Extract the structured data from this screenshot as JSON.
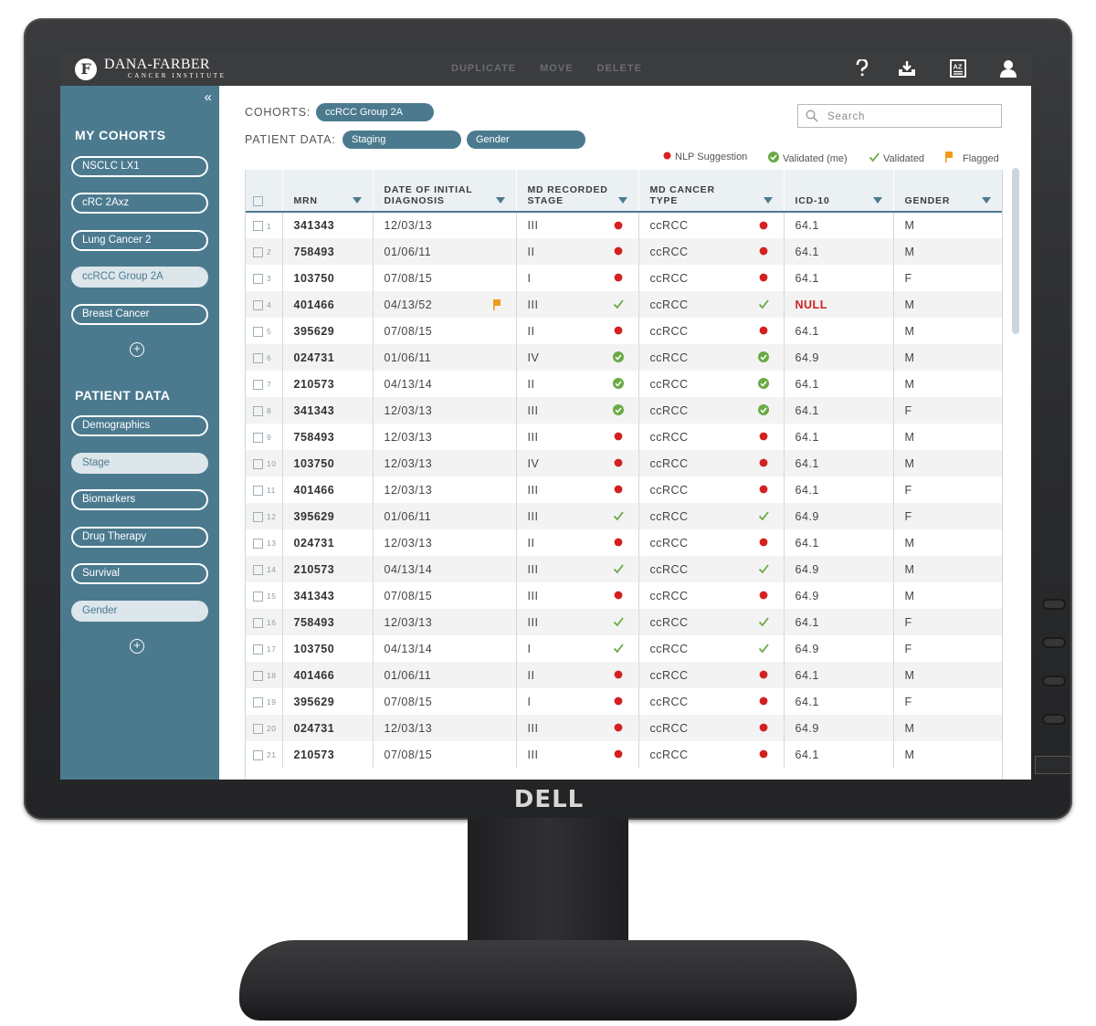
{
  "monitor": {
    "brand": "DELL"
  },
  "app": {
    "org_name": "DANA-FARBER",
    "org_sub": "CANCER INSTITUTE",
    "org_mark": "F",
    "actions": [
      "DUPLICATE",
      "MOVE",
      "DELETE"
    ],
    "icons": [
      "help-icon",
      "export-icon",
      "sort-az-icon",
      "user-icon"
    ]
  },
  "sidebar": {
    "cohorts_heading": "MY COHORTS",
    "cohorts": [
      {
        "label": "NSCLC LX1",
        "active": false
      },
      {
        "label": "cRC 2Axz",
        "active": false
      },
      {
        "label": "Lung Cancer 2",
        "active": false
      },
      {
        "label": "ccRCC Group 2A",
        "active": true
      },
      {
        "label": "Breast Cancer",
        "active": false
      }
    ],
    "patient_heading": "PATIENT DATA",
    "patient_data": [
      {
        "label": "Demographics",
        "active": false
      },
      {
        "label": "Stage",
        "active": true
      },
      {
        "label": "Biomarkers",
        "active": false
      },
      {
        "label": "Drug Therapy",
        "active": false
      },
      {
        "label": "Survival",
        "active": false
      },
      {
        "label": "Gender",
        "active": true
      }
    ]
  },
  "filters": {
    "cohorts_label": "COHORTS:",
    "cohort_chip": "ccRCC Group 2A",
    "patient_label": "PATIENT DATA:",
    "patient_chips": [
      "Staging",
      "Gender"
    ]
  },
  "search": {
    "placeholder": "Search"
  },
  "legend": {
    "nlp": "NLP Suggestion",
    "validated_me": "Validated (me)",
    "validated": "Validated",
    "flagged": "Flagged",
    "colors": {
      "nlp": "#d42020",
      "validated": "#6aaa45",
      "flagged": "#f29a1a"
    }
  },
  "table": {
    "columns": [
      "MRN",
      "DATE OF INITIAL DIAGNOSIS",
      "MD RECORDED STAGE",
      "MD CANCER TYPE",
      "ICD-10",
      "GENDER"
    ],
    "rows": [
      {
        "n": "1",
        "mrn": "341343",
        "date": "12/03/13",
        "stage": "III",
        "stage_s": "dot",
        "type": "ccRCC",
        "type_s": "dot",
        "icd": "64.1",
        "gender": "M"
      },
      {
        "n": "2",
        "mrn": "758493",
        "date": "01/06/11",
        "stage": "II",
        "stage_s": "dot",
        "type": "ccRCC",
        "type_s": "dot",
        "icd": "64.1",
        "gender": "M"
      },
      {
        "n": "3",
        "mrn": "103750",
        "date": "07/08/15",
        "stage": "I",
        "stage_s": "dot",
        "type": "ccRCC",
        "type_s": "dot",
        "icd": "64.1",
        "gender": "F"
      },
      {
        "n": "4",
        "mrn": "401466",
        "date": "04/13/52",
        "flag": true,
        "stage": "III",
        "stage_s": "check",
        "type": "ccRCC",
        "type_s": "check",
        "icd": "NULL",
        "gender": "M"
      },
      {
        "n": "5",
        "mrn": "395629",
        "date": "07/08/15",
        "stage": "II",
        "stage_s": "dot",
        "type": "ccRCC",
        "type_s": "dot",
        "icd": "64.1",
        "gender": "M"
      },
      {
        "n": "6",
        "mrn": "024731",
        "date": "01/06/11",
        "stage": "IV",
        "stage_s": "circle",
        "type": "ccRCC",
        "type_s": "circle",
        "icd": "64.9",
        "gender": "M"
      },
      {
        "n": "7",
        "mrn": "210573",
        "date": "04/13/14",
        "stage": "II",
        "stage_s": "circle",
        "type": "ccRCC",
        "type_s": "circle",
        "icd": "64.1",
        "gender": "M"
      },
      {
        "n": "8",
        "mrn": "341343",
        "date": "12/03/13",
        "stage": "III",
        "stage_s": "circle",
        "type": "ccRCC",
        "type_s": "circle",
        "icd": "64.1",
        "gender": "F"
      },
      {
        "n": "9",
        "mrn": "758493",
        "date": "12/03/13",
        "stage": "III",
        "stage_s": "dot",
        "type": "ccRCC",
        "type_s": "dot",
        "icd": "64.1",
        "gender": "M"
      },
      {
        "n": "10",
        "mrn": "103750",
        "date": "12/03/13",
        "stage": "IV",
        "stage_s": "dot",
        "type": "ccRCC",
        "type_s": "dot",
        "icd": "64.1",
        "gender": "M"
      },
      {
        "n": "11",
        "mrn": "401466",
        "date": "12/03/13",
        "stage": "III",
        "stage_s": "dot",
        "type": "ccRCC",
        "type_s": "dot",
        "icd": "64.1",
        "gender": "F"
      },
      {
        "n": "12",
        "mrn": "395629",
        "date": "01/06/11",
        "stage": "III",
        "stage_s": "check",
        "type": "ccRCC",
        "type_s": "check",
        "icd": "64.9",
        "gender": "F"
      },
      {
        "n": "13",
        "mrn": "024731",
        "date": "12/03/13",
        "stage": "II",
        "stage_s": "dot",
        "type": "ccRCC",
        "type_s": "dot",
        "icd": "64.1",
        "gender": "M"
      },
      {
        "n": "14",
        "mrn": "210573",
        "date": "04/13/14",
        "stage": "III",
        "stage_s": "check",
        "type": "ccRCC",
        "type_s": "check",
        "icd": "64.9",
        "gender": "M"
      },
      {
        "n": "15",
        "mrn": "341343",
        "date": "07/08/15",
        "stage": "III",
        "stage_s": "dot",
        "type": "ccRCC",
        "type_s": "dot",
        "icd": "64.9",
        "gender": "M"
      },
      {
        "n": "16",
        "mrn": "758493",
        "date": "12/03/13",
        "stage": "III",
        "stage_s": "check",
        "type": "ccRCC",
        "type_s": "check",
        "icd": "64.1",
        "gender": "F"
      },
      {
        "n": "17",
        "mrn": "103750",
        "date": "04/13/14",
        "stage": "I",
        "stage_s": "check",
        "type": "ccRCC",
        "type_s": "check",
        "icd": "64.9",
        "gender": "F"
      },
      {
        "n": "18",
        "mrn": "401466",
        "date": "01/06/11",
        "stage": "II",
        "stage_s": "dot",
        "type": "ccRCC",
        "type_s": "dot",
        "icd": "64.1",
        "gender": "M"
      },
      {
        "n": "19",
        "mrn": "395629",
        "date": "07/08/15",
        "stage": "I",
        "stage_s": "dot",
        "type": "ccRCC",
        "type_s": "dot",
        "icd": "64.1",
        "gender": "F"
      },
      {
        "n": "20",
        "mrn": "024731",
        "date": "12/03/13",
        "stage": "III",
        "stage_s": "dot",
        "type": "ccRCC",
        "type_s": "dot",
        "icd": "64.9",
        "gender": "M"
      },
      {
        "n": "21",
        "mrn": "210573",
        "date": "07/08/15",
        "stage": "III",
        "stage_s": "dot",
        "type": "ccRCC",
        "type_s": "dot",
        "icd": "64.1",
        "gender": "M"
      }
    ]
  }
}
